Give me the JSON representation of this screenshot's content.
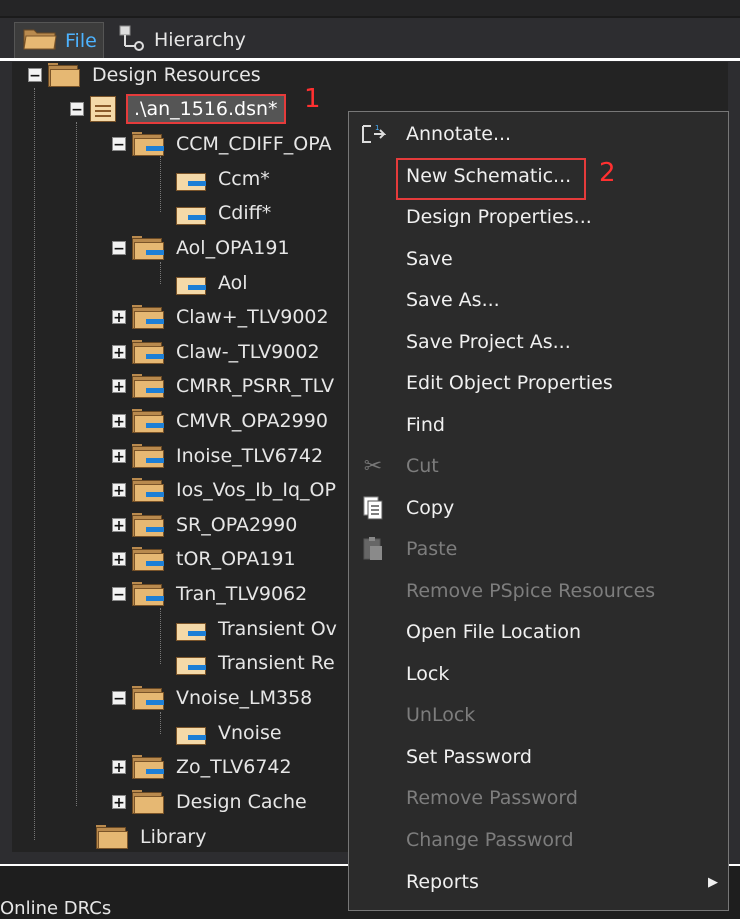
{
  "tabs": [
    {
      "label": "File"
    },
    {
      "label": "Hierarchy"
    }
  ],
  "tree": {
    "root": "Design Resources",
    "design_file": ".\\an_1516.dsn*",
    "folders": [
      "CCM_CDIFF_OPA",
      "Ccm*",
      "Cdiff*",
      "Aol_OPA191",
      "Aol",
      "Claw+_TLV9002",
      "Claw-_TLV9002",
      "CMRR_PSRR_TLV",
      "CMVR_OPA2990",
      "Inoise_TLV6742",
      "Ios_Vos_Ib_Iq_OP",
      "SR_OPA2990",
      "tOR_OPA191",
      "Tran_TLV9062",
      "Transient Ov",
      "Transient Re",
      "Vnoise_LM358",
      "Vnoise",
      "Zo_TLV6742",
      "Design Cache"
    ],
    "library": "Library"
  },
  "annotations": {
    "step1": "1",
    "step2": "2"
  },
  "menu": {
    "items": [
      {
        "label": "Annotate...",
        "enabled": true,
        "icon": "annotate-icon"
      },
      {
        "label": "New Schematic...",
        "enabled": true
      },
      {
        "label": "Design Properties...",
        "enabled": true
      },
      {
        "label": "Save",
        "enabled": true
      },
      {
        "label": "Save As...",
        "enabled": true
      },
      {
        "label": "Save Project As...",
        "enabled": true
      },
      {
        "label": "Edit Object Properties",
        "enabled": true
      },
      {
        "label": "Find",
        "enabled": true
      },
      {
        "label": "Cut",
        "enabled": false,
        "icon": "scissors-icon"
      },
      {
        "label": "Copy",
        "enabled": true,
        "icon": "copy-icon"
      },
      {
        "label": "Paste",
        "enabled": false,
        "icon": "paste-icon"
      },
      {
        "label": "Remove PSpice Resources",
        "enabled": false
      },
      {
        "label": "Open File Location",
        "enabled": true
      },
      {
        "label": "Lock",
        "enabled": true
      },
      {
        "label": "UnLock",
        "enabled": false
      },
      {
        "label": "Set Password",
        "enabled": true
      },
      {
        "label": "Remove Password",
        "enabled": false
      },
      {
        "label": "Change Password",
        "enabled": false
      },
      {
        "label": "Reports",
        "enabled": true,
        "submenu": true
      }
    ]
  },
  "status": {
    "text": "Online DRCs"
  }
}
